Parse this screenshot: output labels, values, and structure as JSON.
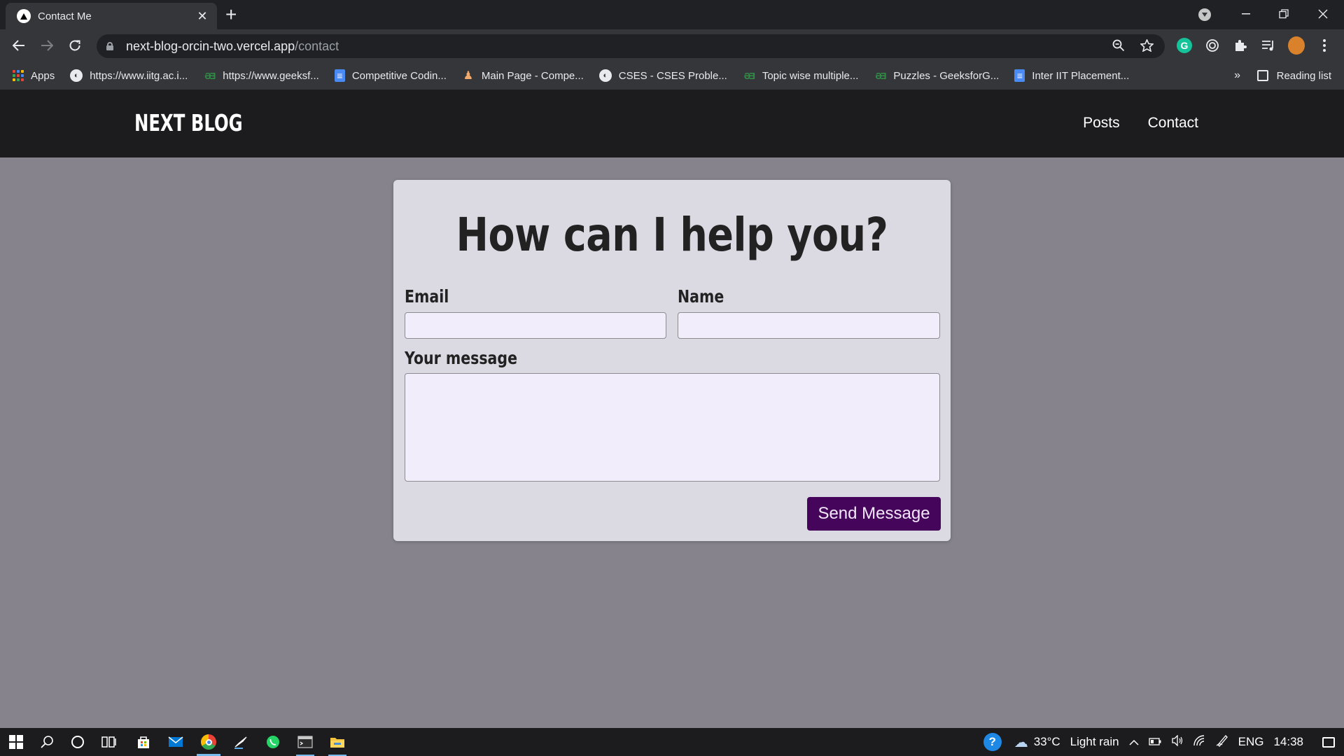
{
  "browser": {
    "tab_title": "Contact Me",
    "tab_close": "✕",
    "new_tab": "+",
    "url_host": "next-blog-orcin-two.vercel.app",
    "url_path": "/contact",
    "bookmarks": [
      {
        "label": "Apps",
        "icon": "apps-icon"
      },
      {
        "label": "https://www.iitg.ac.i...",
        "icon": "globe-icon"
      },
      {
        "label": "https://www.geeksf...",
        "icon": "geeksforgeeks-icon"
      },
      {
        "label": "Competitive Codin...",
        "icon": "google-docs-icon"
      },
      {
        "label": "Main Page - Compe...",
        "icon": "codeforces-icon"
      },
      {
        "label": "CSES - CSES Proble...",
        "icon": "globe-icon"
      },
      {
        "label": "Topic wise multiple...",
        "icon": "geeksforgeeks-icon"
      },
      {
        "label": "Puzzles - GeeksforG...",
        "icon": "geeksforgeeks-icon"
      },
      {
        "label": "Inter IIT Placement...",
        "icon": "google-docs-icon"
      }
    ],
    "bookmarks_more": "»",
    "reading_list": "Reading list"
  },
  "site": {
    "logo": "NEXT BLOG",
    "nav": [
      "Posts",
      "Contact"
    ]
  },
  "contact_form": {
    "heading": "How can I help you?",
    "email_label": "Email",
    "name_label": "Name",
    "message_label": "Your message",
    "email_value": "",
    "name_value": "",
    "message_value": "",
    "submit_label": "Send Message",
    "accent_color": "#45055b"
  },
  "taskbar": {
    "weather_temp": "33°C",
    "weather_desc": "Light rain",
    "language": "ENG",
    "time": "14:38"
  }
}
